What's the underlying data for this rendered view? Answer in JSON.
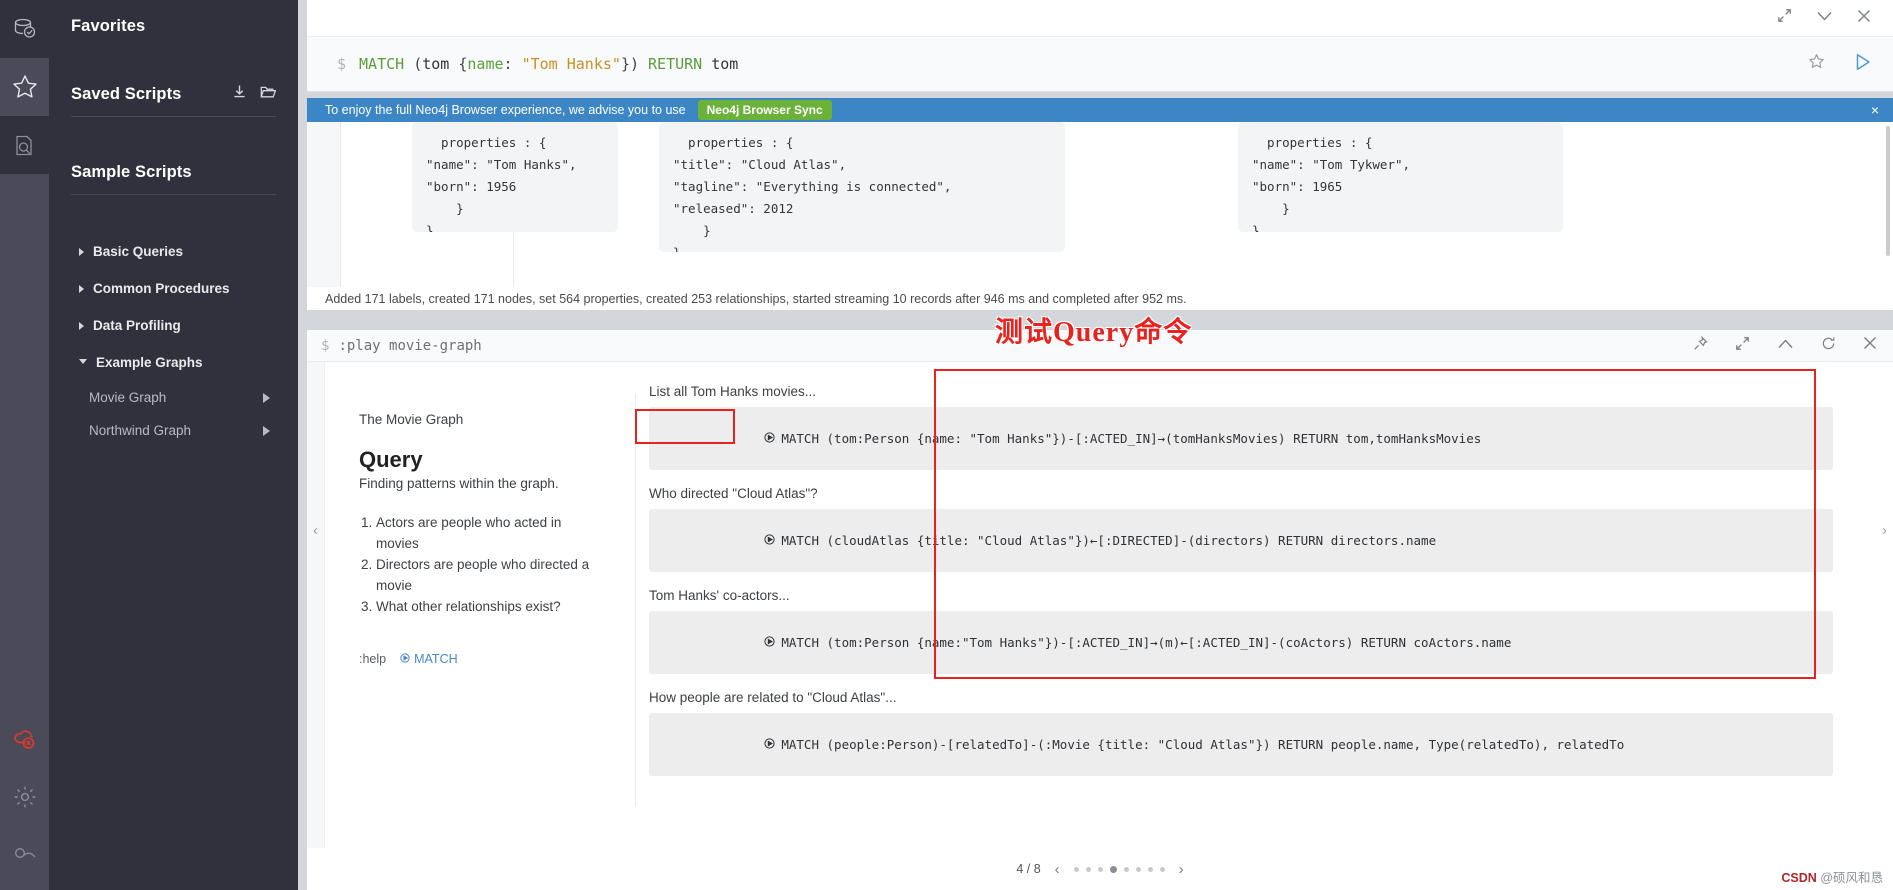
{
  "sidebar": {
    "rail": [
      {
        "name": "database-icon",
        "title": "Database"
      },
      {
        "name": "favorites-star-icon",
        "title": "Favorites"
      },
      {
        "name": "documents-icon",
        "title": "Documents"
      }
    ],
    "rail_bottom": [
      {
        "name": "cloud-disconnected-icon",
        "title": "Browser Sync disconnected"
      },
      {
        "name": "gear-icon",
        "title": "Settings"
      },
      {
        "name": "about-icon",
        "title": "About"
      }
    ],
    "favorites_title": "Favorites",
    "saved_scripts_title": "Saved Scripts",
    "saved_scripts_icons": [
      "download-icon",
      "folder-icon"
    ],
    "sample_scripts_title": "Sample Scripts",
    "tree": [
      {
        "label": "Basic Queries",
        "open": false
      },
      {
        "label": "Common Procedures",
        "open": false
      },
      {
        "label": "Data Profiling",
        "open": false
      },
      {
        "label": "Example Graphs",
        "open": true
      }
    ],
    "example_graphs": [
      {
        "label": "Movie Graph"
      },
      {
        "label": "Northwind Graph"
      }
    ]
  },
  "editor": {
    "prompt": "$",
    "query_tokens": [
      {
        "t": "MATCH ",
        "c": "k-kw"
      },
      {
        "t": "(",
        "c": "k-punct"
      },
      {
        "t": "tom ",
        "c": "k-var"
      },
      {
        "t": "{",
        "c": "k-punct"
      },
      {
        "t": "name",
        "c": "k-prop"
      },
      {
        "t": ": ",
        "c": "k-punct"
      },
      {
        "t": "\"Tom Hanks\"",
        "c": "k-str"
      },
      {
        "t": "})",
        "c": "k-punct"
      },
      {
        "t": " RETURN ",
        "c": "k-kw"
      },
      {
        "t": "tom",
        "c": "k-var"
      }
    ],
    "query_plain": "MATCH (tom {name: \"Tom Hanks\"}) RETURN tom",
    "top_icons": [
      "expand-icon",
      "chevron-down-icon",
      "close-icon"
    ],
    "line_icons": [
      "favorite-star-icon",
      "run-play-icon"
    ]
  },
  "banner": {
    "text": "To enjoy the full Neo4j Browser experience, we advise you to use",
    "cta": "Neo4j Browser Sync",
    "close": "×",
    "bg": "#3d86c6",
    "cta_bg": "#6bb13a"
  },
  "result": {
    "cards": [
      "  properties : {\n\"name\": \"Tom Hanks\",\n\"born\": 1956\n    }\n}",
      "  properties : {\n\"title\": \"Cloud Atlas\",\n\"tagline\": \"Everything is connected\",\n\"released\": 2012\n    }\n}",
      "  properties : {\n\"name\": \"Tom Tykwer\",\n\"born\": 1965\n    }\n}"
    ],
    "status": "Added 171 labels, created 171 nodes, set 564 properties, created 253 relationships, started streaming 10 records after 946 ms and completed after 952 ms."
  },
  "play": {
    "prompt": "$",
    "command": ":play movie-graph",
    "tools": [
      "pin-icon",
      "expand-icon",
      "chevron-up-icon",
      "refresh-icon",
      "close-icon"
    ],
    "guide": {
      "subtitle": "The Movie Graph",
      "title": "Query",
      "lead": "Finding patterns within the graph.",
      "list": [
        "Actors are people who acted in movies",
        "Directors are people who directed a movie",
        "What other relationships exist?"
      ],
      "help_label": ":help",
      "help_link": "MATCH"
    },
    "queries": [
      {
        "label": "List all Tom Hanks movies...",
        "code": "MATCH (tom:Person {name: \"Tom Hanks\"})-[:ACTED_IN]→(tomHanksMovies) RETURN tom,tomHanksMovies"
      },
      {
        "label": "Who directed \"Cloud Atlas\"?",
        "code": "MATCH (cloudAtlas {title: \"Cloud Atlas\"})←[:DIRECTED]-(directors) RETURN directors.name"
      },
      {
        "label": "Tom Hanks' co-actors...",
        "code": "MATCH (tom:Person {name:\"Tom Hanks\"})-[:ACTED_IN]→(m)←[:ACTED_IN]-(coActors) RETURN coActors.name"
      },
      {
        "label": "How people are related to \"Cloud Atlas\"...",
        "code": "MATCH (people:Person)-[relatedTo]-(:Movie {title: \"Cloud Atlas\"}) RETURN people.name, Type(relatedTo), relatedTo"
      }
    ],
    "pager": {
      "current": "4 / 8",
      "prev": "‹",
      "next": "›",
      "total_dots": 8,
      "active_dot": 4
    }
  },
  "annotations": {
    "chinese_note": "测试Query命令",
    "highlight_color": "#e8231f"
  },
  "watermark": {
    "site": "CSDN",
    "author": "@硕风和恳"
  }
}
